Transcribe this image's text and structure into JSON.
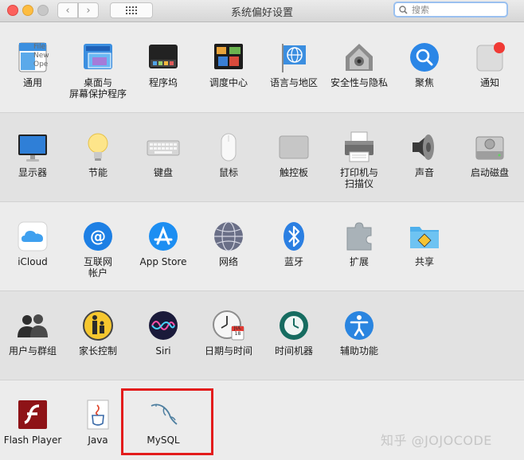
{
  "window": {
    "title": "系统偏好设置"
  },
  "toolbar": {
    "back": "‹",
    "forward": "›"
  },
  "search": {
    "placeholder": "搜索"
  },
  "rows": [
    [
      {
        "label": "通用",
        "icon": "general-icon",
        "badge": "File\nNew\nOpe"
      },
      {
        "label": "桌面与\n屏幕保护程序",
        "icon": "desktop-screensaver-icon"
      },
      {
        "label": "程序坞",
        "icon": "dock-icon"
      },
      {
        "label": "调度中心",
        "icon": "mission-control-icon"
      },
      {
        "label": "语言与地区",
        "icon": "language-region-icon"
      },
      {
        "label": "安全性与隐私",
        "icon": "security-privacy-icon"
      },
      {
        "label": "聚焦",
        "icon": "spotlight-icon"
      },
      {
        "label": "通知",
        "icon": "notifications-icon"
      }
    ],
    [
      {
        "label": "显示器",
        "icon": "displays-icon"
      },
      {
        "label": "节能",
        "icon": "energy-saver-icon"
      },
      {
        "label": "键盘",
        "icon": "keyboard-icon"
      },
      {
        "label": "鼠标",
        "icon": "mouse-icon"
      },
      {
        "label": "触控板",
        "icon": "trackpad-icon"
      },
      {
        "label": "打印机与\n扫描仪",
        "icon": "printer-scanner-icon"
      },
      {
        "label": "声音",
        "icon": "sound-icon"
      },
      {
        "label": "启动磁盘",
        "icon": "startup-disk-icon"
      }
    ],
    [
      {
        "label": "iCloud",
        "icon": "icloud-icon"
      },
      {
        "label": "互联网\n帐户",
        "icon": "internet-accounts-icon"
      },
      {
        "label": "App Store",
        "icon": "app-store-icon"
      },
      {
        "label": "网络",
        "icon": "network-icon"
      },
      {
        "label": "蓝牙",
        "icon": "bluetooth-icon"
      },
      {
        "label": "扩展",
        "icon": "extensions-icon"
      },
      {
        "label": "共享",
        "icon": "sharing-icon"
      }
    ],
    [
      {
        "label": "用户与群组",
        "icon": "users-groups-icon"
      },
      {
        "label": "家长控制",
        "icon": "parental-controls-icon"
      },
      {
        "label": "Siri",
        "icon": "siri-icon"
      },
      {
        "label": "日期与时间",
        "icon": "date-time-icon",
        "badge": "JUL\n18"
      },
      {
        "label": "时间机器",
        "icon": "time-machine-icon"
      },
      {
        "label": "辅助功能",
        "icon": "accessibility-icon"
      }
    ],
    [
      {
        "label": "Flash Player",
        "icon": "flash-player-icon"
      },
      {
        "label": "Java",
        "icon": "java-icon"
      },
      {
        "label": "MySQL",
        "icon": "mysql-icon"
      }
    ]
  ],
  "watermark": "知乎 @JOJOCODE"
}
